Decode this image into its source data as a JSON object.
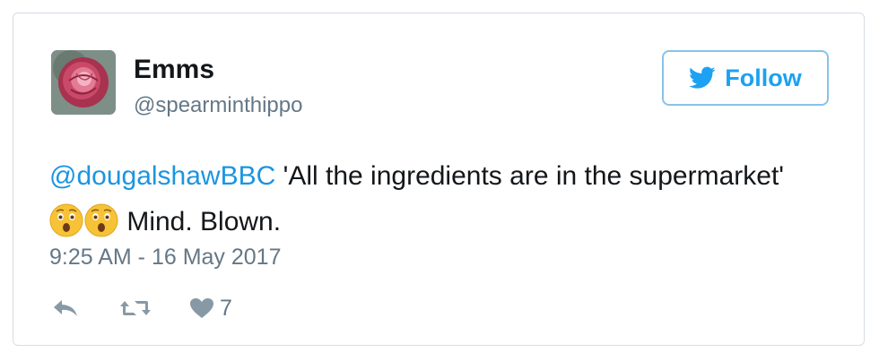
{
  "user": {
    "display_name": "Emms",
    "handle": "@spearminthippo"
  },
  "follow_button": {
    "label": "Follow",
    "icon": "twitter-bird-icon"
  },
  "tweet": {
    "mention": "@dougalshawBBC",
    "text_part1": " 'All the ingredients are in the supermarket' ",
    "emojis": [
      "astonished-face-emoji",
      "astonished-face-emoji"
    ],
    "text_part2": " Mind. Blown.",
    "timestamp": "9:25 AM - 16 May 2017"
  },
  "actions": {
    "reply_icon": "reply-icon",
    "retweet_icon": "retweet-icon",
    "like_icon": "heart-icon",
    "like_count": "7"
  },
  "colors": {
    "link": "#1b95e0",
    "follow_border": "#86c3ea",
    "muted_text": "#657786",
    "action_icon": "#8899a6"
  }
}
